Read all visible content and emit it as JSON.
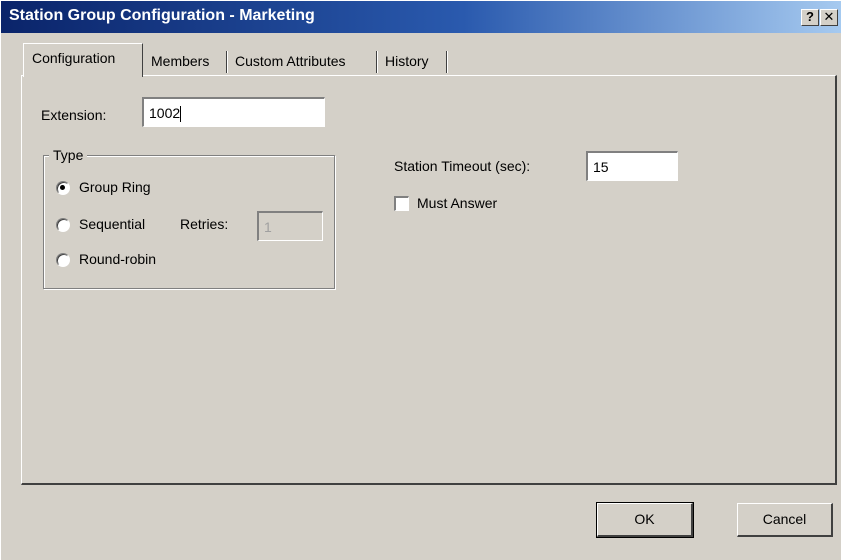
{
  "window": {
    "title": "Station Group Configuration - Marketing",
    "help_label": "?",
    "close_label": "✕"
  },
  "tabs": [
    {
      "label": "Configuration",
      "active": true
    },
    {
      "label": "Members",
      "active": false
    },
    {
      "label": "Custom Attributes",
      "active": false
    },
    {
      "label": "History",
      "active": false
    }
  ],
  "form": {
    "extension_label": "Extension:",
    "extension_value": "1002",
    "type_group_title": "Type",
    "radio_group_ring": {
      "label": "Group Ring",
      "checked": true
    },
    "radio_sequential": {
      "label": "Sequential",
      "checked": false
    },
    "radio_round_robin": {
      "label": "Round-robin",
      "checked": false
    },
    "retries_label": "Retries:",
    "retries_value": "1",
    "station_timeout_label": "Station Timeout (sec):",
    "station_timeout_value": "15",
    "must_answer_label": "Must Answer",
    "must_answer_checked": false
  },
  "buttons": {
    "ok_label": "OK",
    "cancel_label": "Cancel"
  },
  "colors": {
    "title_gradient_start": "#0a246a",
    "title_gradient_end": "#a6caf0",
    "window_bg": "#d4d0c8"
  }
}
